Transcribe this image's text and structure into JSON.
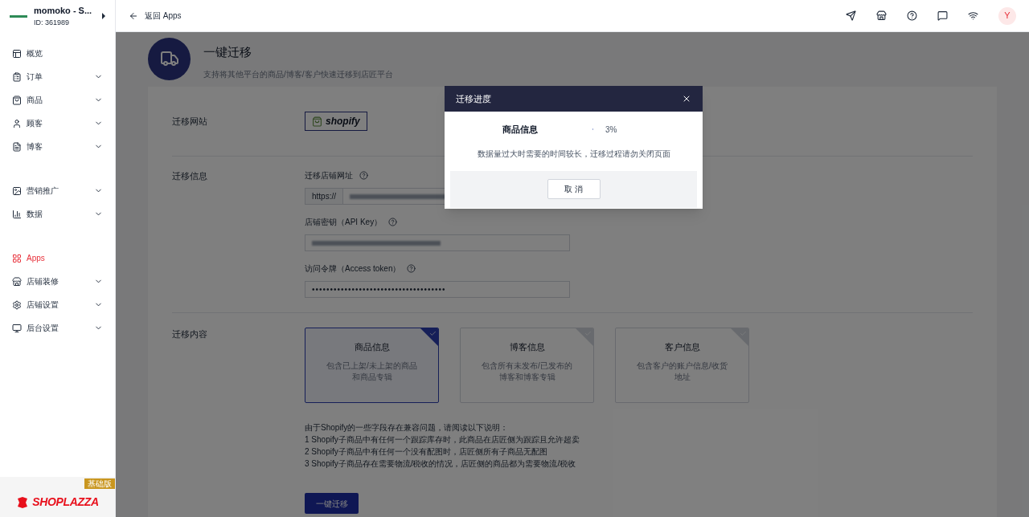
{
  "store": {
    "name": "momoko - S...",
    "id": "ID: 361989"
  },
  "sidebar": {
    "groups": [
      [
        {
          "label": "概览",
          "collapsible": false,
          "selected": false
        },
        {
          "label": "订单",
          "collapsible": true,
          "selected": false
        },
        {
          "label": "商品",
          "collapsible": true,
          "selected": false
        },
        {
          "label": "顾客",
          "collapsible": true,
          "selected": false
        },
        {
          "label": "博客",
          "collapsible": true,
          "selected": false
        }
      ],
      [
        {
          "label": "营销推广",
          "collapsible": true,
          "selected": false
        },
        {
          "label": "数据",
          "collapsible": true,
          "selected": false
        }
      ],
      [
        {
          "label": "Apps",
          "collapsible": false,
          "selected": true
        },
        {
          "label": "店铺装修",
          "collapsible": true,
          "selected": false
        },
        {
          "label": "店铺设置",
          "collapsible": true,
          "selected": false
        },
        {
          "label": "后台设置",
          "collapsible": true,
          "selected": false
        }
      ]
    ]
  },
  "brand": {
    "logo": "SHOPLAZZA",
    "plan": "基础版"
  },
  "topbar": {
    "back": "返回 Apps",
    "avatar": "Y"
  },
  "page": {
    "title": "一键迁移",
    "subtitle": "支持将其他平台的商品/博客/客户快速迁移到店匠平台"
  },
  "source": {
    "label": "迁移网站",
    "platform": "shopify"
  },
  "info": {
    "label": "迁移信息",
    "fields": [
      {
        "label": "迁移店铺网址",
        "prefix": "https://",
        "kind": "blurred"
      },
      {
        "label": "店铺密钥（API Key）",
        "kind": "blurred"
      },
      {
        "label": "访问令牌（Access token）",
        "kind": "masked",
        "value": "•••••••••••••••••••••••••••••••••••••"
      }
    ]
  },
  "content": {
    "label": "迁移内容",
    "options": [
      {
        "title": "商品信息",
        "description": "包含已上架/未上架的商品和商品专辑",
        "selected": true
      },
      {
        "title": "博客信息",
        "description": "包含所有未发布/已发布的博客和博客专辑",
        "selected": false
      },
      {
        "title": "客户信息",
        "description": "包含客户的账户信息/收货地址",
        "selected": false
      }
    ],
    "notes": [
      "由于Shopify的一些字段存在兼容问题，请阅读以下说明：",
      "1 Shopify子商品中有任何一个跟踪库存时，此商品在店匠侧为跟踪且允许超卖",
      "2 Shopify子商品中有任何一个没有配图时，店匠侧所有子商品无配图",
      "3 Shopify子商品存在需要物流/税收的情况，店匠侧的商品都为需要物流/税收"
    ],
    "submit": "一键迁移"
  },
  "dialog": {
    "title": "迁移进度",
    "item": "商品信息",
    "level": 0.03,
    "percent": "3%",
    "note": "数据量过大时需要的时间较长，迁移过程请勿关闭页面",
    "cancel": "取 消"
  }
}
